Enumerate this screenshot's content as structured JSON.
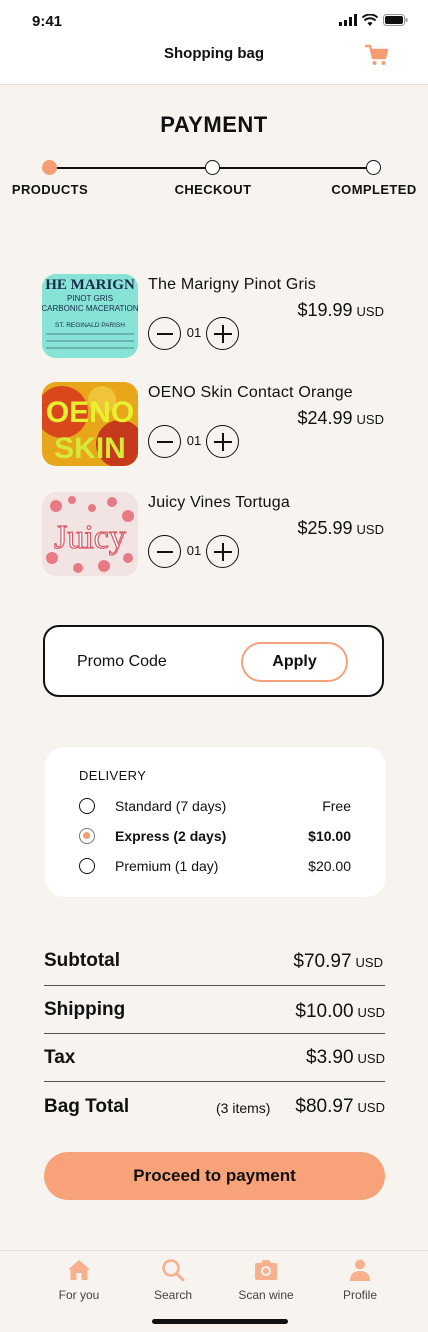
{
  "status_bar": {
    "time": "9:41"
  },
  "header": {
    "title": "Shopping bag"
  },
  "page": {
    "title": "PAYMENT"
  },
  "steps": [
    {
      "label": "PRODUCTS",
      "active": true
    },
    {
      "label": "CHECKOUT",
      "active": false
    },
    {
      "label": "COMPLETED",
      "active": false
    }
  ],
  "products": [
    {
      "name": "The Marigny Pinot Gris",
      "price": "$19.99",
      "currency": "USD",
      "qty": "01",
      "label_lines": [
        "HE MARIGN",
        "PINOT GRIS",
        "CARBONIC MACERATION",
        "ST. REGINALD PARISH"
      ]
    },
    {
      "name": "OENO Skin Contact Orange",
      "price": "$24.99",
      "currency": "USD",
      "qty": "01",
      "label_lines": [
        "OENO",
        "SKIN"
      ]
    },
    {
      "name": "Juicy Vines Tortuga",
      "price": "$25.99",
      "currency": "USD",
      "qty": "01",
      "label_lines": [
        "Juicy"
      ]
    }
  ],
  "promo": {
    "label": "Promo Code",
    "button": "Apply"
  },
  "delivery": {
    "title": "DELIVERY",
    "options": [
      {
        "label": "Standard (7 days)",
        "price": "Free",
        "selected": false
      },
      {
        "label": "Express (2 days)",
        "price": "$10.00",
        "selected": true
      },
      {
        "label": "Premium (1 day)",
        "price": "$20.00",
        "selected": false
      }
    ]
  },
  "totals": {
    "subtotal": {
      "label": "Subtotal",
      "value": "$70.97",
      "currency": "USD"
    },
    "shipping": {
      "label": "Shipping",
      "value": "$10.00",
      "currency": "USD"
    },
    "tax": {
      "label": "Tax",
      "value": "$3.90",
      "currency": "USD"
    },
    "bag_total": {
      "label": "Bag Total",
      "count": "(3 items)",
      "value": "$80.97",
      "currency": "USD"
    }
  },
  "cta": {
    "label": "Proceed to payment"
  },
  "tabs": [
    {
      "label": "For you",
      "icon": "home-icon"
    },
    {
      "label": "Search",
      "icon": "search-icon"
    },
    {
      "label": "Scan wine",
      "icon": "camera-icon"
    },
    {
      "label": "Profile",
      "icon": "profile-icon"
    }
  ],
  "colors": {
    "accent": "#f59e74",
    "background": "#f7f4ef"
  }
}
